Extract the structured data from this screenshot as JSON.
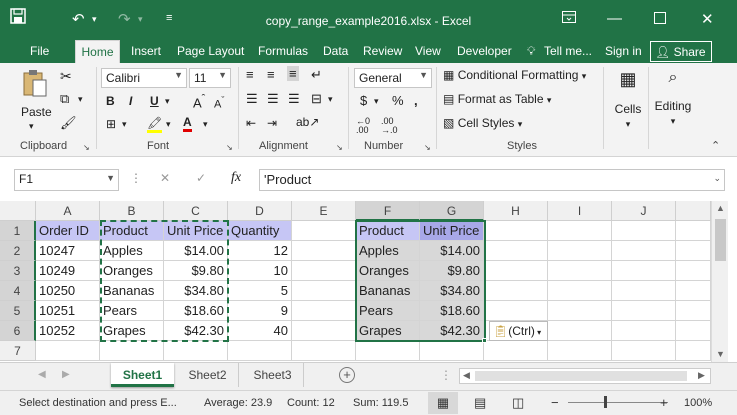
{
  "titlebar": {
    "title": "copy_range_example2016.xlsx - Excel"
  },
  "menu": {
    "file": "File",
    "home": "Home",
    "insert": "Insert",
    "page_layout": "Page Layout",
    "formulas": "Formulas",
    "data": "Data",
    "review": "Review",
    "view": "View",
    "developer": "Developer",
    "tell_me": "Tell me...",
    "sign_in": "Sign in",
    "share": "Share"
  },
  "ribbon": {
    "paste": "Paste",
    "font_name": "Calibri",
    "font_size": "11",
    "number_format": "General",
    "conditional_formatting": "Conditional Formatting",
    "format_as_table": "Format as Table",
    "cell_styles": "Cell Styles",
    "cells": "Cells",
    "editing": "Editing",
    "groups": {
      "clipboard": "Clipboard",
      "font": "Font",
      "alignment": "Alignment",
      "number": "Number",
      "styles": "Styles"
    }
  },
  "formula_bar": {
    "name_box": "F1",
    "formula": "'Product",
    "fx": "fx"
  },
  "columns": [
    "A",
    "B",
    "C",
    "D",
    "E",
    "F",
    "G",
    "H",
    "I",
    "J"
  ],
  "rows": [
    "1",
    "2",
    "3",
    "4",
    "5",
    "6",
    "7"
  ],
  "cells": {
    "A": [
      "Order ID",
      "10247",
      "10249",
      "10250",
      "10251",
      "10252"
    ],
    "B": [
      "Product",
      "Apples",
      "Oranges",
      "Bananas",
      "Pears",
      "Grapes"
    ],
    "C": [
      "Unit Price",
      "$14.00",
      "$9.80",
      "$34.80",
      "$18.60",
      "$42.30"
    ],
    "D": [
      "Quantity",
      "12",
      "10",
      "5",
      "9",
      "40"
    ],
    "F": [
      "Product",
      "Apples",
      "Oranges",
      "Bananas",
      "Pears",
      "Grapes"
    ],
    "G": [
      "Unit Price",
      "$14.00",
      "$9.80",
      "$34.80",
      "$18.60",
      "$42.30"
    ]
  },
  "paste_options": "(Ctrl)",
  "sheets": [
    "Sheet1",
    "Sheet2",
    "Sheet3"
  ],
  "active_sheet": "Sheet1",
  "status": {
    "message": "Select destination and press E...",
    "average": "Average: 23.9",
    "count": "Count: 12",
    "sum": "Sum: 119.5",
    "zoom": "100%"
  },
  "colors": {
    "accent": "#217346",
    "header_fill": "#c6c6f5",
    "selection_fill": "#d8d8d8",
    "selected_header": "#a8a8e8"
  }
}
